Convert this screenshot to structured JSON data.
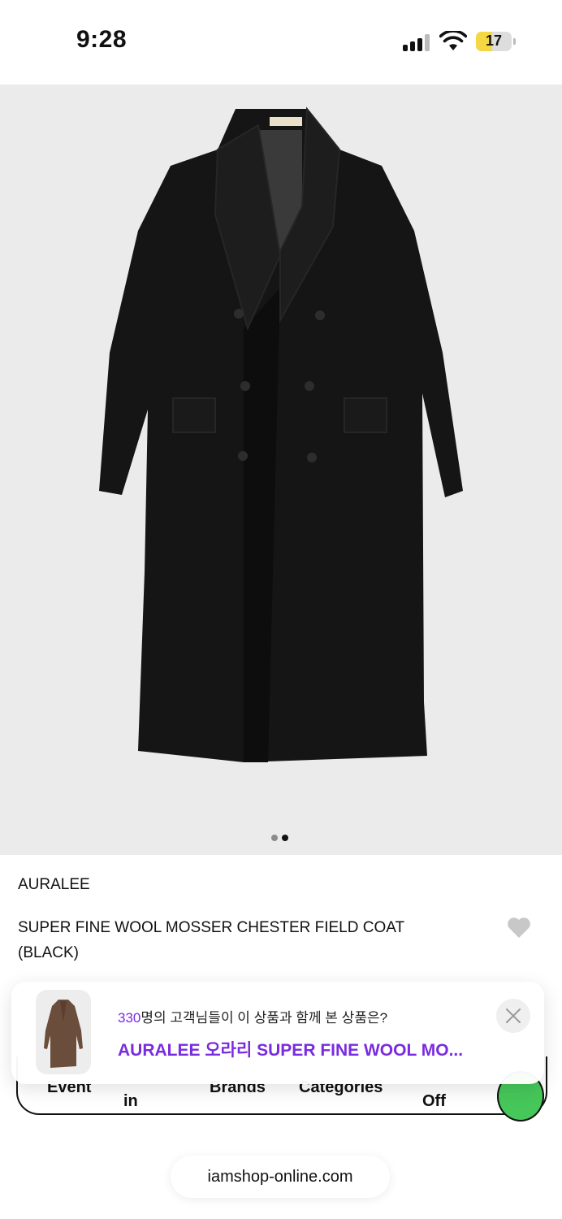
{
  "status_bar": {
    "time": "9:28",
    "battery": "17"
  },
  "product_image": {
    "alt": "black double-breasted long wool coat",
    "pages": 2,
    "active_page": 2
  },
  "product": {
    "brand": "AURALEE",
    "title": "SUPER FINE WOOL MOSSER CHESTER FIELD COAT (BLACK)",
    "wishlist_icon": "heart-icon"
  },
  "bottom_nav": {
    "items": [
      {
        "label": "Event"
      },
      {
        "label": "in"
      },
      {
        "label": "Brands"
      },
      {
        "label": "Categories"
      },
      {
        "label": "Off"
      }
    ]
  },
  "popup": {
    "count": "330",
    "text": "명의 고객님들이 이 상품과 함께 본 상품은?",
    "product_name": "AURALEE 오라리 SUPER FINE WOOL MO...",
    "close_icon": "close-icon"
  },
  "browser": {
    "url": "iamshop-online.com"
  },
  "colors": {
    "accent": "#7a2be0",
    "green": "#46c75a"
  }
}
